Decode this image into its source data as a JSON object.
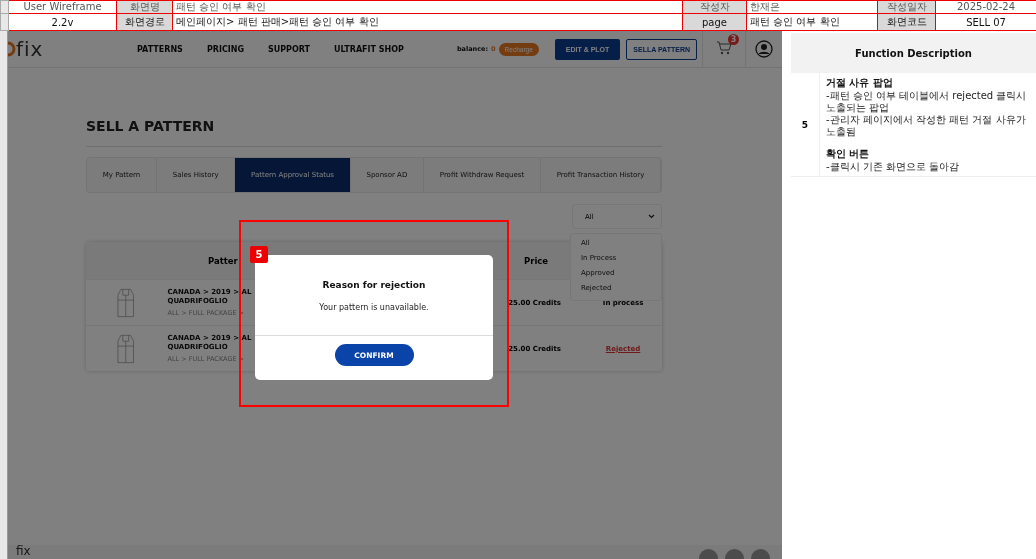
{
  "doc_header": {
    "rows": [
      {
        "cells": [
          "User Wireframe",
          "화면명",
          "패턴 승인 여부 확인",
          "작성자",
          "한재은",
          "작성일자",
          "2025-02-24"
        ]
      },
      {
        "cells": [
          "2.2v",
          "화면경로",
          "메인페이지> 패턴 판매>패턴 승인 여부 확인",
          "page",
          "패턴 승인 여부 확인",
          "화면코드",
          "SELL 07"
        ]
      }
    ]
  },
  "navbar": {
    "logo": "fix",
    "links": [
      "PATTERNS",
      "PRICING",
      "SUPPORT",
      "ULTRAFIT SHOP"
    ],
    "balance_label": "balance:",
    "balance_value": "0",
    "recharge": "Recharge",
    "edit_button": "EDIT & PLOT",
    "sell_button": "SELLA PATTERN",
    "cart_count": "3"
  },
  "page": {
    "title": "SELL A PATTERN",
    "tabs": [
      {
        "label": "My Pattern",
        "selected": false
      },
      {
        "label": "Sales History",
        "selected": false
      },
      {
        "label": "Pattern Approval Status",
        "selected": true
      },
      {
        "label": "Sponsor AD",
        "selected": false
      },
      {
        "label": "Profit Withdraw Request",
        "selected": false
      },
      {
        "label": "Profit Transaction History",
        "selected": false
      }
    ],
    "filter": {
      "value": "All",
      "options": [
        "All",
        "In Process",
        "Approved",
        "Rejected"
      ]
    },
    "table": {
      "columns": [
        "Patter",
        "Price"
      ],
      "rows": [
        {
          "path": "CANADA > 2019 > AL",
          "name": "QUADRIFOGLIO",
          "sub": "ALL > FULL PACKAGE >",
          "price": "25.00 Credits",
          "status": "In process",
          "kind": "in_process"
        },
        {
          "path": "CANADA > 2019 > AL",
          "name": "QUADRIFOGLIO",
          "sub": "ALL > FULL PACKAGE >",
          "price": "25.00 Credits",
          "status": "Rejected",
          "kind": "rejected"
        }
      ]
    }
  },
  "modal": {
    "marker": "5",
    "title": "Reason for rejection",
    "message": "Your pattern is unavailable.",
    "button": "CONFIRM"
  },
  "description": {
    "title": "Function Description",
    "rows": [
      {
        "number": "5",
        "items": [
          {
            "heading": "거절 사유 팝업",
            "lines": [
              "-패턴 승인 여부 테이블에서 rejected 클릭시 노출되는 팝업",
              "-관리자 페이지에서 작성한 패턴 거절 사유가 노출됨"
            ]
          },
          {
            "heading": "확인 버튼",
            "lines": [
              "-클릭시 기존 화면으로 돌아감"
            ]
          }
        ]
      }
    ]
  },
  "footer": {
    "logo": "fix"
  }
}
